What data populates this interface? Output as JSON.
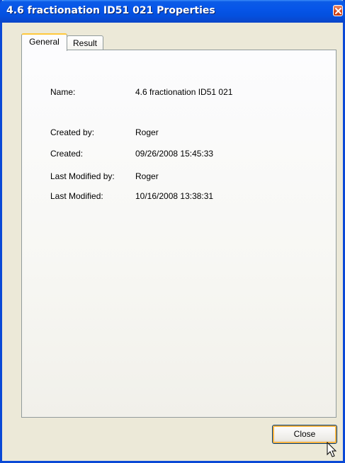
{
  "window": {
    "title": "4.6 fractionation ID51 021 Properties"
  },
  "tabs": [
    {
      "label": "General",
      "active": true
    },
    {
      "label": "Result",
      "active": false
    }
  ],
  "properties": {
    "name_label": "Name:",
    "name_value": "4.6 fractionation ID51 021",
    "created_by_label": "Created by:",
    "created_by_value": "Roger",
    "created_label": "Created:",
    "created_value": "09/26/2008 15:45:33",
    "last_modified_by_label": "Last Modified by:",
    "last_modified_by_value": "Roger",
    "last_modified_label": "Last Modified:",
    "last_modified_value": "10/16/2008 13:38:31"
  },
  "buttons": {
    "close_label": "Close"
  },
  "icons": {
    "title_close": "close-icon",
    "pointer": "mouse-cursor-icon"
  },
  "colors": {
    "titlebar": "#0655e8",
    "window_bg": "#ece9d8",
    "active_tab_accent": "#ffc83c",
    "close_button_focus": "#f8b342",
    "title_close_bg": "#d6461a"
  }
}
